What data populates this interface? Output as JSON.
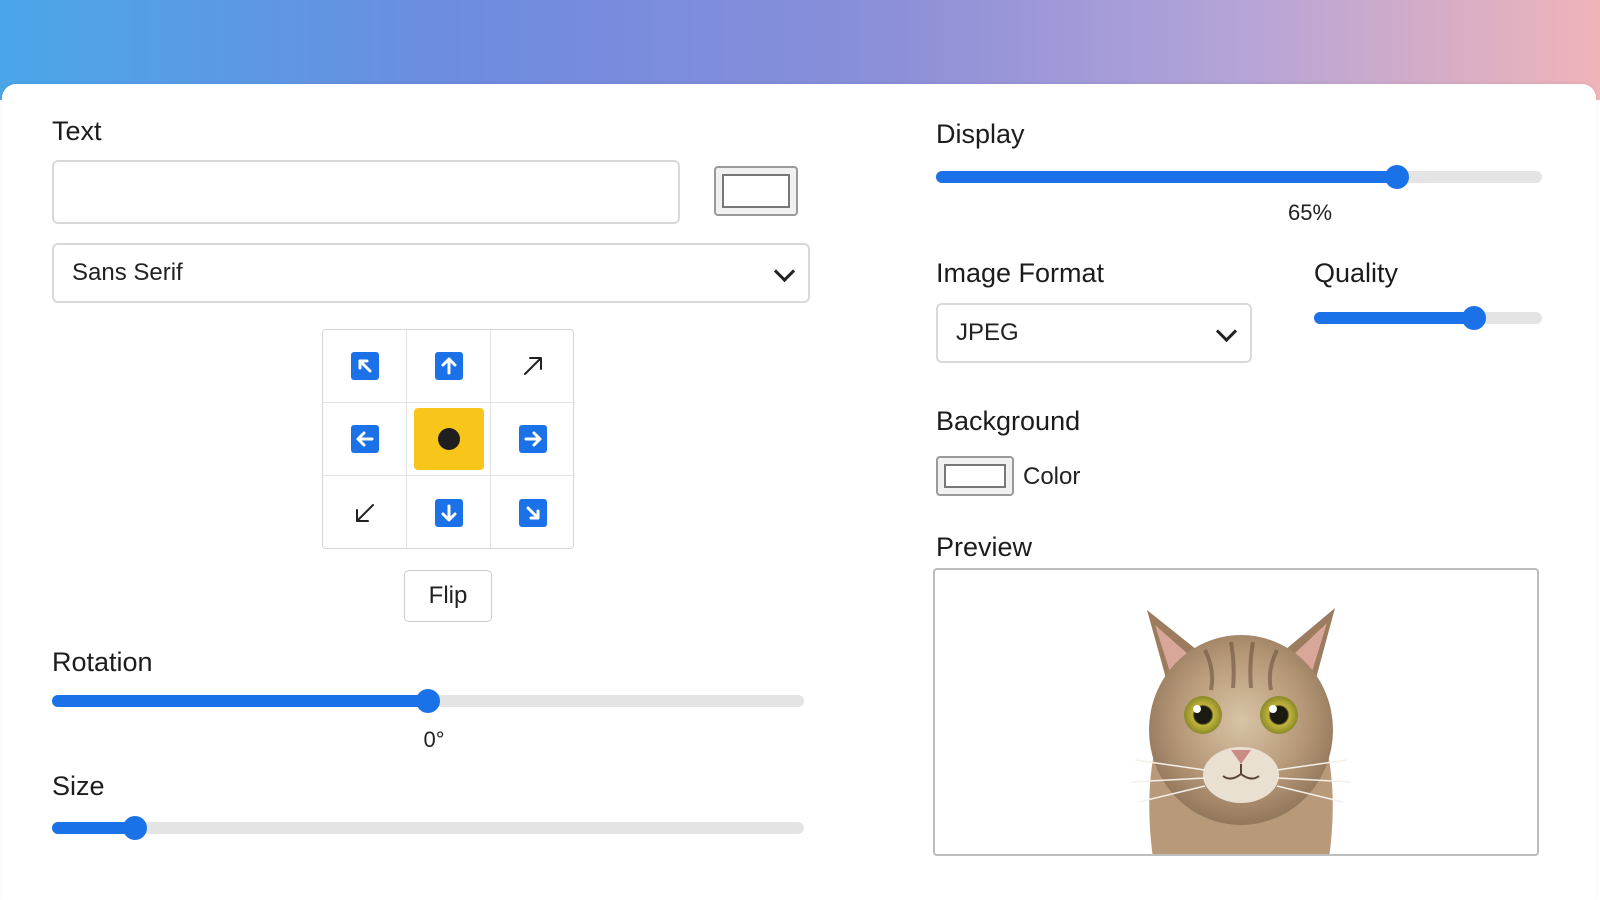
{
  "left": {
    "text_label": "Text",
    "text_value": "",
    "font_select": {
      "selected": "Sans Serif"
    },
    "position_grid": {
      "cells": [
        {
          "icon": "arrow-up-left-icon",
          "style": "blue"
        },
        {
          "icon": "arrow-up-icon",
          "style": "blue"
        },
        {
          "icon": "arrow-up-right-icon",
          "style": "plain"
        },
        {
          "icon": "arrow-left-icon",
          "style": "blue"
        },
        {
          "icon": "center-dot-icon",
          "style": "selected"
        },
        {
          "icon": "arrow-right-icon",
          "style": "blue"
        },
        {
          "icon": "arrow-down-left-icon",
          "style": "plain"
        },
        {
          "icon": "arrow-down-icon",
          "style": "blue"
        },
        {
          "icon": "arrow-down-right-icon",
          "style": "blue"
        }
      ]
    },
    "flip_label": "Flip",
    "rotation_label": "Rotation",
    "rotation_value_text": "0°",
    "rotation_fraction": 0.5,
    "size_label": "Size",
    "size_fraction": 0.11
  },
  "right": {
    "display_label": "Display",
    "display_value_text": "65%",
    "display_fraction": 0.76,
    "image_format_label": "Image Format",
    "image_format_selected": "JPEG",
    "quality_label": "Quality",
    "quality_fraction": 0.7,
    "background_label": "Background",
    "background_color_label": "Color",
    "preview_label": "Preview"
  },
  "colors": {
    "accent": "#1b72e8",
    "selected": "#f8c51b",
    "banner_start": "#4aa6e8",
    "banner_end": "#f0b4b8"
  }
}
